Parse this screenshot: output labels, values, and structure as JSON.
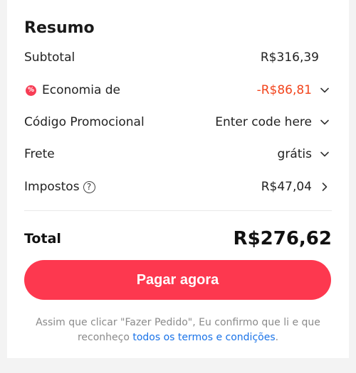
{
  "summary": {
    "title": "Resumo",
    "subtotal": {
      "label": "Subtotal",
      "value": "R$316,39"
    },
    "savings": {
      "label": "Economia de",
      "value": "-R$86,81",
      "badge": "%"
    },
    "promo": {
      "label": "Código Promocional",
      "value": "Enter code here"
    },
    "shipping": {
      "label": "Frete",
      "value": "grátis"
    },
    "taxes": {
      "label": "Impostos",
      "help": "?",
      "value": "R$47,04"
    },
    "total": {
      "label": "Total",
      "value": "R$276,62"
    },
    "pay_button": "Pagar agora",
    "disclaimer": {
      "text": "Assim que clicar \"Fazer Pedido\", Eu confirmo que li e que reconheço ",
      "link": "todos os termos e condições",
      "suffix": "."
    }
  },
  "colors": {
    "accent": "#fd384f",
    "savings": "#f2441c",
    "link": "#1a73e8",
    "muted": "#8a8a8a"
  },
  "icons": [
    "discount-badge-icon",
    "chevron-down-icon",
    "chevron-right-icon",
    "help-icon"
  ]
}
